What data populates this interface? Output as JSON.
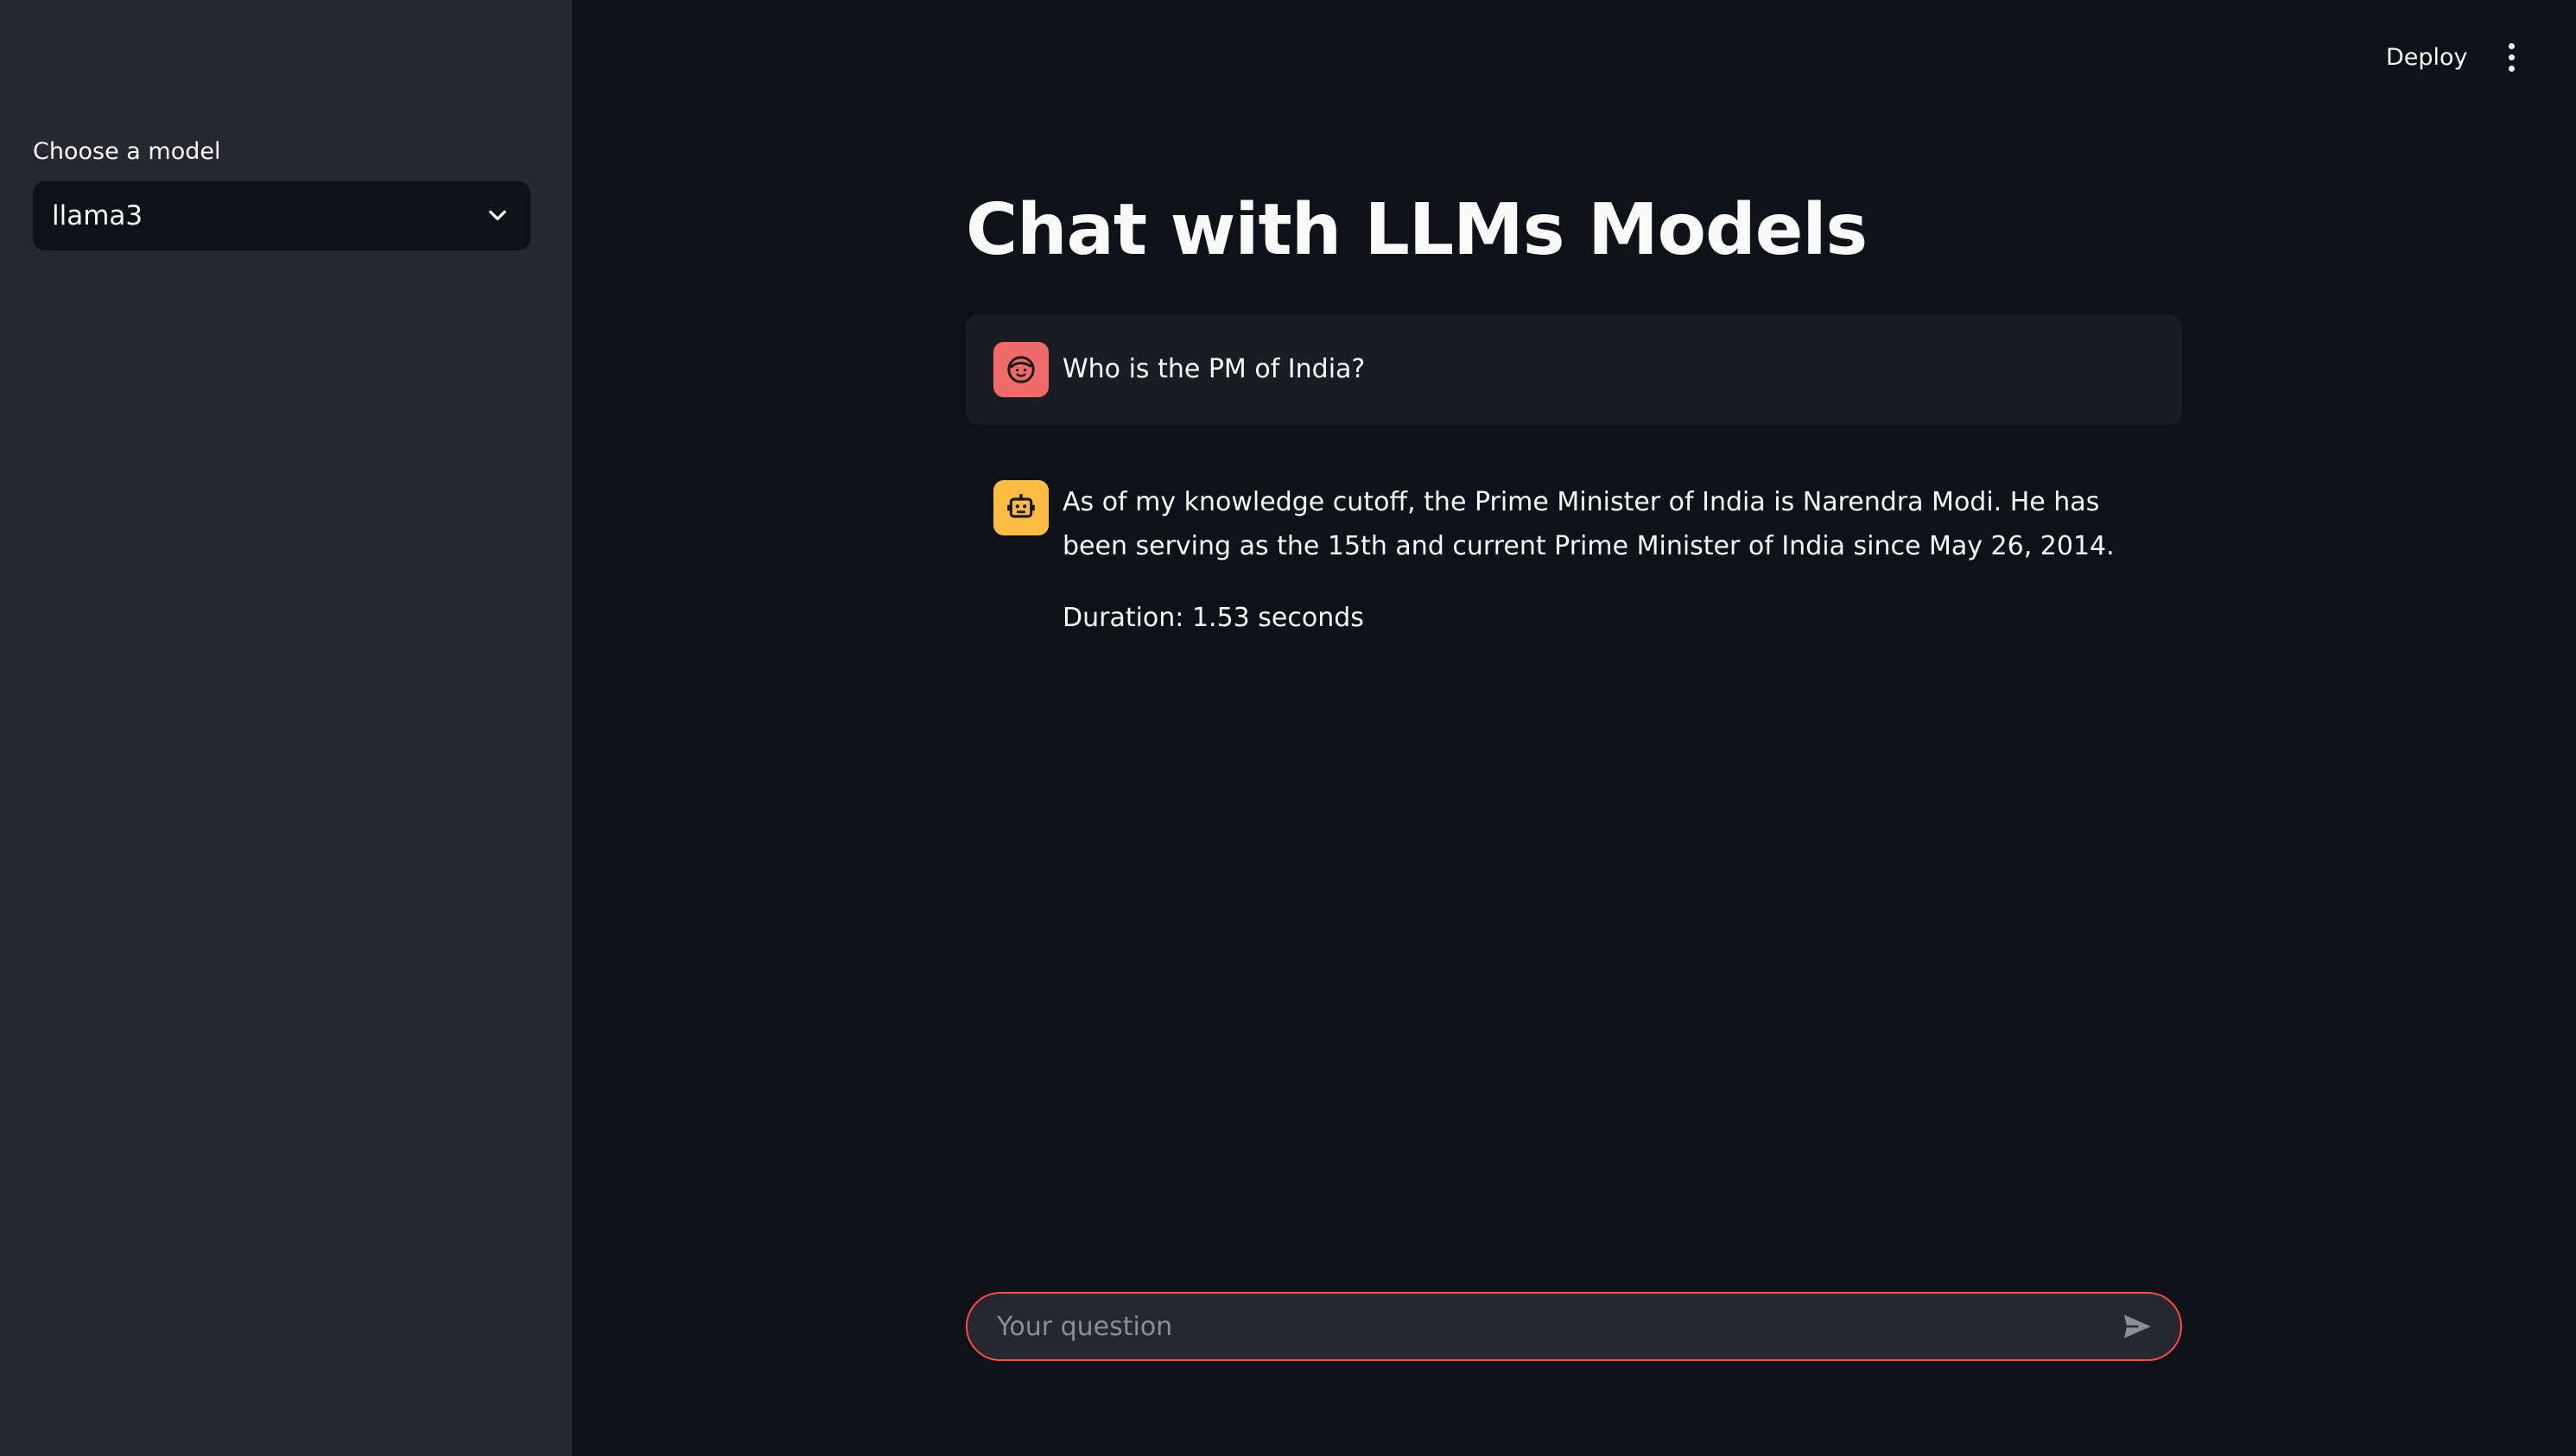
{
  "sidebar": {
    "model_label": "Choose a model",
    "model_selected": "llama3",
    "chevron_icon": "chevron-down-icon"
  },
  "header": {
    "deploy_label": "Deploy",
    "menu_icon": "vertical-ellipsis-icon"
  },
  "main": {
    "title": "Chat with LLMs Models",
    "messages": [
      {
        "role": "user",
        "avatar_icon": "user-face-icon",
        "text": "Who is the PM of India?"
      },
      {
        "role": "assistant",
        "avatar_icon": "robot-icon",
        "text": "As of my knowledge cutoff, the Prime Minister of India is Narendra Modi. He has been serving as the 15th and current Prime Minister of India since May 26, 2014.",
        "duration": "Duration: 1.53 seconds"
      }
    ]
  },
  "chat_input": {
    "placeholder": "Your question",
    "send_icon": "send-icon",
    "border_color": "#ff4b4b"
  },
  "colors": {
    "sidebar_bg": "#262730",
    "main_bg": "#0e1117",
    "user_avatar": "#f06a6a",
    "bot_avatar": "#ffbd45"
  }
}
